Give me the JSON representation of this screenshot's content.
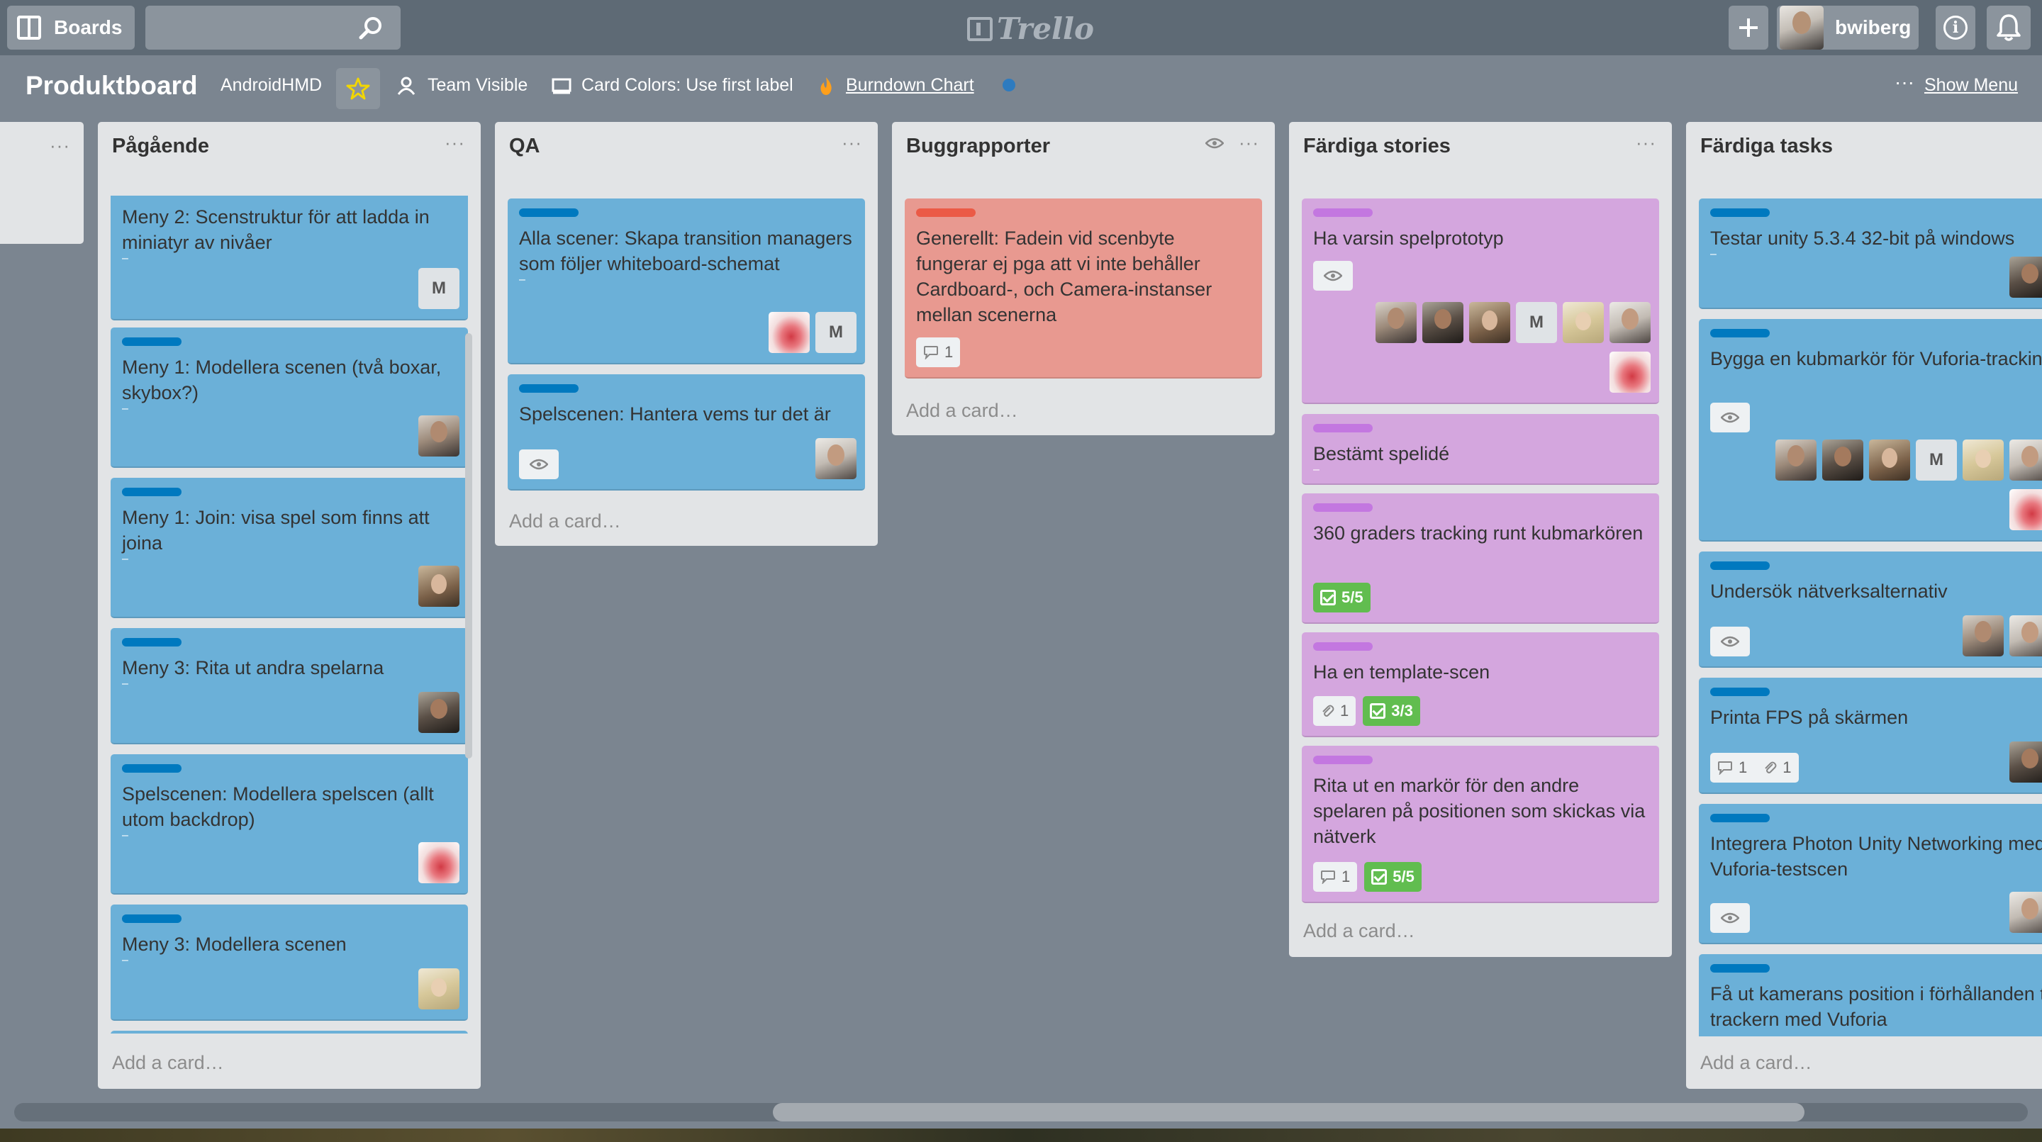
{
  "topbar": {
    "boards_label": "Boards",
    "search_placeholder": "",
    "logo_text": "Trello",
    "username": "bwiberg",
    "info_glyph": "i"
  },
  "board": {
    "title": "Produktboard",
    "team": "AndroidHMD",
    "visibility": "Team Visible",
    "card_colors": "Card Colors: Use first label",
    "burndown": "Burndown Chart",
    "show_menu": "Show Menu",
    "menu_dots": "···"
  },
  "add_card_label": "Add a card…",
  "lists": [
    {
      "title": "Pågående",
      "cards": [
        {
          "text": "Meny 2: Scenstruktur för att ladda in miniatyr av nivåer",
          "initial": "M"
        },
        {
          "text": "Meny 1: Modellera scenen (två boxar, skybox?)"
        },
        {
          "text": "Meny 1: Join: visa spel som finns att joina"
        },
        {
          "text": "Meny 3: Rita ut andra spelarna"
        },
        {
          "text": "Spelscenen: Modellera spelscen (allt utom backdrop)"
        },
        {
          "text": "Meny 3: Modellera scenen"
        }
      ]
    },
    {
      "title": "QA",
      "cards": [
        {
          "text": "Alla scener: Skapa transition managers som följer whiteboard-schemat",
          "initial": "M"
        },
        {
          "text": "Spelscenen: Hantera vems tur det är"
        }
      ]
    },
    {
      "title": "Buggrapporter",
      "cards": [
        {
          "text": "Generellt: Fadein vid scenbyte fungerar ej pga att vi inte behåller Cardboard-, och Camera-instanser mellan scenerna",
          "comments": "1"
        }
      ]
    },
    {
      "title": "Färdiga stories",
      "cards": [
        {
          "text": "Ha varsin spelprototyp",
          "initial": "M"
        },
        {
          "text": "Bestämt spelidé"
        },
        {
          "text": "360 graders tracking runt kubmarkören",
          "checklist": "5/5"
        },
        {
          "text": "Ha en template-scen",
          "attachments": "1",
          "checklist": "3/3"
        },
        {
          "text": "Rita ut en markör för den andre spelaren på positionen som skickas via nätverk",
          "comments": "1",
          "checklist": "5/5"
        }
      ]
    },
    {
      "title": "Färdiga tasks",
      "cards": [
        {
          "text": "Testar unity 5.3.4 32-bit på windows"
        },
        {
          "text": "Bygga en kubmarkör för Vuforia-tracking",
          "initial": "M"
        },
        {
          "text": "Undersök nätverksalternativ"
        },
        {
          "text": "Printa FPS på skärmen",
          "comments": "1",
          "attachments": "1"
        },
        {
          "text": "Integrera Photon Unity Networking med Vuforia-testscen"
        },
        {
          "text": "Få ut kamerans position i förhållanden till trackern med Vuforia"
        }
      ]
    }
  ],
  "colors": {
    "label_blue": "#0079bf",
    "label_purple": "#c377e0",
    "label_red": "#eb5a46",
    "checklist_green": "#61bd4f",
    "visibility_dot": "#2e7bbf"
  },
  "icons": [
    "boards-icon",
    "search-icon",
    "trello-logo",
    "plus-icon",
    "info-icon",
    "bell-icon",
    "star-icon",
    "team-icon",
    "card-colors-icon",
    "burndown-icon",
    "eye-icon",
    "comment-icon",
    "attachment-icon",
    "checklist-icon"
  ]
}
